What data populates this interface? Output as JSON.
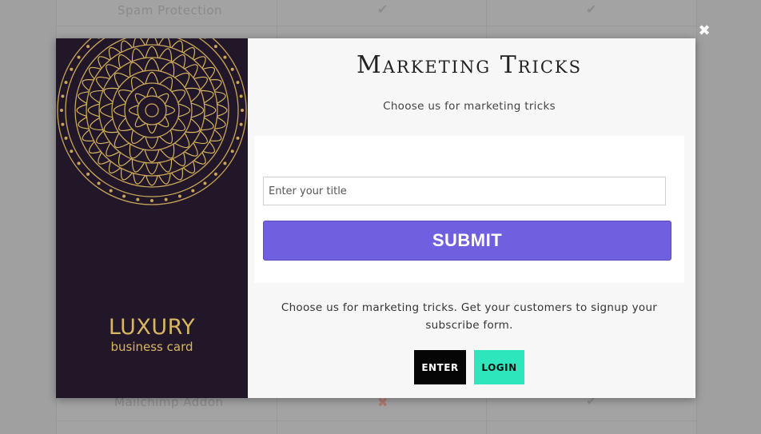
{
  "background": {
    "rows": [
      {
        "feature": "Spam Protection",
        "col1": "check",
        "col2": "check"
      },
      {
        "feature": "Mailchimp Addon",
        "col1": "cross",
        "col2": "check"
      }
    ],
    "check_icon": "✔",
    "cross_icon": "✖"
  },
  "close": {
    "icon": "close-icon",
    "glyph": "✖"
  },
  "modal": {
    "image": {
      "brand_line1": "LUXURY",
      "brand_line2": "business card"
    },
    "title": "Marketing Tricks",
    "subtitle": "Choose us for marketing tricks",
    "form": {
      "input_placeholder": "Enter your title",
      "input_value": "",
      "submit_label": "SUBMIT"
    },
    "description": "Choose us for marketing tricks. Get your customers to signup your subscribe form.",
    "enter_label": "ENTER",
    "login_label": "LOGIN"
  },
  "colors": {
    "submit": "#7060e0",
    "login": "#2ee6bc",
    "enter": "#050505",
    "image_bg": "#221729",
    "gold": "#d8b760"
  }
}
